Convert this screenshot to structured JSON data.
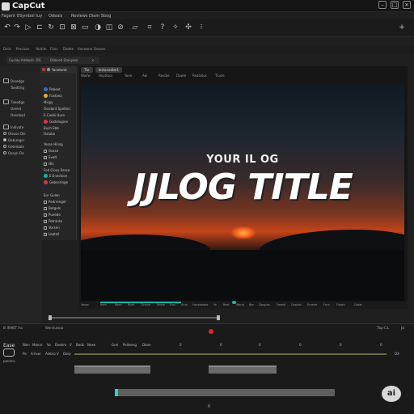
{
  "app": {
    "name": "CapCut"
  },
  "menu": [
    "Fagent 0",
    "Symbol tuy",
    "Odeals",
    "Reviews Diam Sbog"
  ],
  "window_buttons": [
    "–",
    "□",
    "×"
  ],
  "toolbar_icons": [
    "undo-icon",
    "redo-icon",
    "play-icon",
    "split-icon",
    "rotate-icon",
    "crop-icon",
    "delete-icon",
    "freeze-icon",
    "mask-icon",
    "mirror-icon",
    "speed-icon",
    "voice-icon",
    "text-icon",
    "help-icon",
    "magic-icon",
    "marker-icon",
    "more-icon"
  ],
  "tabs": [
    "Delis",
    "Previsas",
    "Yordim",
    "Fries",
    "Delete",
    "Aeewone",
    "Snoves"
  ],
  "section_bar": [
    "Cucaly Ambosh .DG",
    "Ddeceh Stanyset",
    "×"
  ],
  "left_panel": [
    {
      "label": "Doredge"
    },
    {
      "label": "Toedting"
    },
    {
      "label": "Tneedge"
    },
    {
      "label": "Oeeiet"
    },
    {
      "label": "Ovenbad"
    },
    {
      "label": "Indivate"
    },
    {
      "label": "Oleuse Dle"
    },
    {
      "label": "Oetoreger"
    },
    {
      "label": "Geterbale"
    },
    {
      "label": "Oseyn Fle"
    }
  ],
  "clip_panel": {
    "header": "Yanetomt",
    "items": [
      {
        "label": "Pebeet",
        "color": "#3a6bd8"
      },
      {
        "label": "Fuebiea",
        "color": "#e0b030"
      },
      {
        "label": "Mispy"
      },
      {
        "label": "Ossdant Spelten"
      },
      {
        "label": "E Ceebi Hure"
      },
      {
        "label": "Godelegore",
        "color": "#d03a4a"
      },
      {
        "label": "Bush Ebb"
      },
      {
        "label": "Ostabe"
      },
      {
        "label": "Yesse Hiling"
      },
      {
        "label": "Gosse"
      },
      {
        "label": "Evelt"
      },
      {
        "label": "Oki"
      },
      {
        "label": "Fod Clous Resse"
      },
      {
        "label": "E Enectoce",
        "color": "#19b3a3"
      },
      {
        "label": "Gebceringe",
        "color": "#d03a4a"
      },
      {
        "label": "Enr Gulen"
      },
      {
        "label": "Pedrrengel"
      },
      {
        "label": "Betgels"
      },
      {
        "label": "Pueede"
      },
      {
        "label": "Petrante"
      },
      {
        "label": "Vorsen"
      },
      {
        "label": "Leptell"
      }
    ]
  },
  "preview": {
    "chips": [
      "Thr",
      "Instanedtm1"
    ],
    "tabs": [
      "Waifw",
      "Haytlacs",
      "Yaee",
      "Aw",
      "Revibe",
      "Dawle",
      "Reatatus",
      "Tiusle"
    ],
    "subtitle": "YOUR IL OG",
    "title": "JJLOG TITLE",
    "effects": [
      "Yosse",
      "Rom",
      "Roon",
      "Rum",
      "Cinsoe",
      "Noole",
      "Essl",
      "Anio",
      "Hockorsate",
      "Yo",
      "Rest",
      "Wourl",
      "Bar",
      "Dasplas",
      "Fosedl",
      "Goselal",
      "Ereeler",
      "Fora",
      "Fixteb",
      "Gatar"
    ]
  },
  "timeline": {
    "bar": [
      "Ill lRMST lhs",
      "Wernlutesa"
    ],
    "right": [
      "Tbp-C:L",
      "Jsi"
    ],
    "row1": [
      "Ease",
      "Wen",
      "Maner",
      "Vo",
      "Deolim",
      "V",
      "Bedk",
      "Nexe",
      "Grel",
      "Pelleeng",
      "Dooe"
    ],
    "row2": [
      "Pa",
      "A-hser",
      "Alebro",
      "V",
      "Dorp",
      "DX"
    ],
    "sublabel": "panens",
    "time_marks": [
      "0",
      "0",
      "0",
      "0",
      "0",
      "0"
    ],
    "ai_label": "ai",
    "pause_label": "II"
  }
}
